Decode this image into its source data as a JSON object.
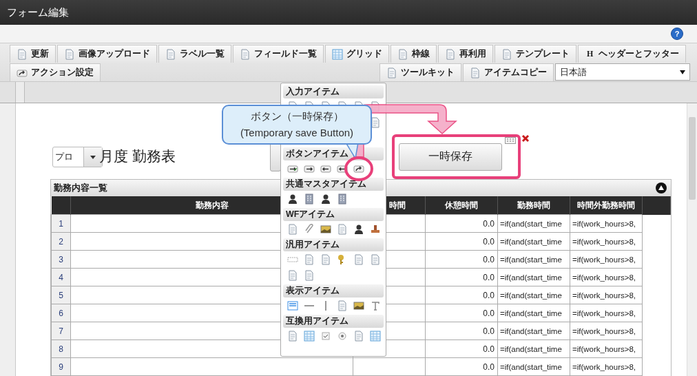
{
  "window": {
    "title": "フォーム編集"
  },
  "help_button": {
    "label": "?"
  },
  "toolbar": {
    "row1": [
      {
        "label": "更新"
      },
      {
        "label": "画像アップロード"
      },
      {
        "label": "ラベル一覧"
      },
      {
        "label": "フィールド一覧"
      },
      {
        "label": "グリッド"
      },
      {
        "label": "枠線"
      },
      {
        "label": "再利用"
      },
      {
        "label": "テンプレート"
      },
      {
        "label": "ヘッダーとフッター",
        "glyph": "H"
      }
    ],
    "row2_left": [
      {
        "label": "アクション設定"
      }
    ],
    "row2_right": [
      {
        "label": "ツールキット"
      },
      {
        "label": "アイテムコピー"
      }
    ],
    "language_select": {
      "value": "日本語"
    }
  },
  "form": {
    "month_select": {
      "value": "プロ"
    },
    "title": "月度 勤務表",
    "placed_button": {
      "label": "一時保存"
    },
    "table": {
      "title": "勤務内容一覧",
      "columns": [
        "勤務内容",
        "時間",
        "休憩時間",
        "勤務時間",
        "時間外勤務時間"
      ],
      "rows": [
        {
          "no": "1",
          "break_time": "0.0",
          "work_hours": "=if(and(start_time",
          "overtime": "=if(work_hours>8,"
        },
        {
          "no": "2",
          "break_time": "0.0",
          "work_hours": "=if(and(start_time",
          "overtime": "=if(work_hours>8,"
        },
        {
          "no": "3",
          "break_time": "0.0",
          "work_hours": "=if(and(start_time",
          "overtime": "=if(work_hours>8,"
        },
        {
          "no": "4",
          "break_time": "0.0",
          "work_hours": "=if(and(start_time",
          "overtime": "=if(work_hours>8,"
        },
        {
          "no": "5",
          "break_time": "0.0",
          "work_hours": "=if(and(start_time",
          "overtime": "=if(work_hours>8,"
        },
        {
          "no": "6",
          "break_time": "0.0",
          "work_hours": "=if(and(start_time",
          "overtime": "=if(work_hours>8,"
        },
        {
          "no": "7",
          "break_time": "0.0",
          "work_hours": "=if(and(start_time",
          "overtime": "=if(work_hours>8,"
        },
        {
          "no": "8",
          "break_time": "0.0",
          "work_hours": "=if(and(start_time",
          "overtime": "=if(work_hours>8,"
        },
        {
          "no": "9",
          "break_time": "0.0",
          "work_hours": "=if(and(start_time",
          "overtime": "=if(work_hours>8,"
        }
      ]
    }
  },
  "palette": {
    "sections": [
      {
        "kind": "input",
        "title": "入力アイテム"
      },
      {
        "kind": "button",
        "title": "ボタンアイテム"
      },
      {
        "kind": "master",
        "title": "共通マスタアイテム"
      },
      {
        "kind": "wf",
        "title": "WFアイテム"
      },
      {
        "kind": "general",
        "title": "汎用アイテム"
      },
      {
        "kind": "display",
        "title": "表示アイテム"
      },
      {
        "kind": "compat",
        "title": "互換用アイテム"
      }
    ]
  },
  "callout": {
    "lines": [
      "ボタン（一時保存）",
      "(Temporary save Button)"
    ]
  }
}
